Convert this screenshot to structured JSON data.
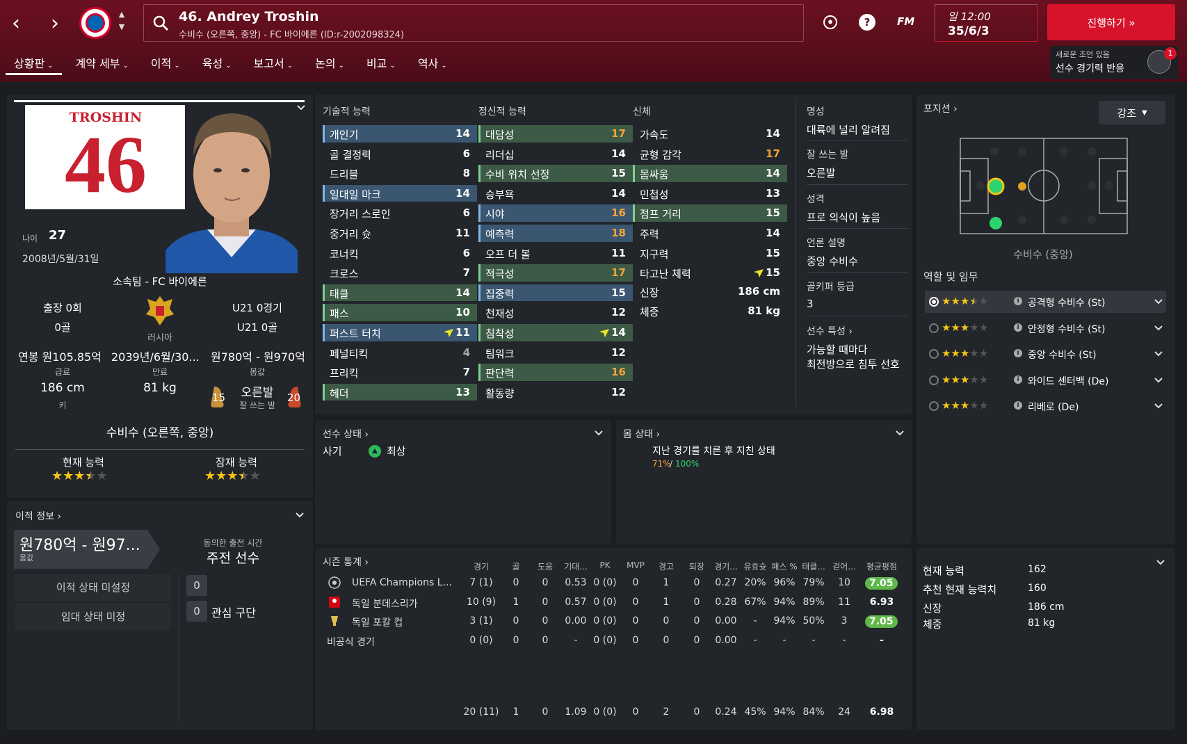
{
  "header": {
    "player_title": "46. Andrey Troshin",
    "player_sub": "수비수 (오른쪽, 중앙) - FC 바이에른 (ID:r-2002098324)",
    "fm_label": "FM",
    "time": "일 12:00",
    "date": "35/6/3",
    "continue_label": "진행하기 »",
    "notice_line1": "새로운 조언 있음",
    "notice_line2": "선수 경기력 반응",
    "notice_badge": "1"
  },
  "tabs": [
    {
      "label": "상황판"
    },
    {
      "label": "계약 세부"
    },
    {
      "label": "이적"
    },
    {
      "label": "육성"
    },
    {
      "label": "보고서"
    },
    {
      "label": "논의"
    },
    {
      "label": "비교"
    },
    {
      "label": "역사"
    }
  ],
  "profile": {
    "jersey_name": "TROSHIN",
    "jersey_number": "46",
    "age_label": "나이",
    "age": "27",
    "dob": "2008년/5월/31일",
    "club": "소속팀 - FC 바이에른",
    "apps": "출장 0회",
    "goals": "0골",
    "nation": "러시아",
    "u21_apps": "U21 0경기",
    "u21_goals": "U21 0골",
    "wage": "연봉 원105.85억",
    "expiry": "2039년/6월/30...",
    "value": "원780억 - 원970억",
    "wage_label": "급료",
    "expiry_label": "만료",
    "value_label": "몸값",
    "height": "186 cm",
    "height_label": "키",
    "weight": "81 kg",
    "foot": "오른발",
    "foot_label": "잘 쓰는 발",
    "left_foot_val": "15",
    "right_foot_val": "20",
    "position": "수비수 (오른쪽, 중앙)",
    "ca_label": "현재 능력",
    "pa_label": "잠재 능력",
    "ca_stars": 3.5,
    "pa_stars": 3.5
  },
  "attributes": {
    "tech_head": "기술적 능력",
    "mental_head": "정신적 능력",
    "phys_head": "신체",
    "technical": [
      {
        "name": "개인기",
        "value": "14",
        "hl": "blue"
      },
      {
        "name": "골 결정력",
        "value": "6",
        "hl": ""
      },
      {
        "name": "드리블",
        "value": "8",
        "hl": ""
      },
      {
        "name": "일대일 마크",
        "value": "14",
        "hl": "blue"
      },
      {
        "name": "장거리 스로인",
        "value": "6",
        "hl": ""
      },
      {
        "name": "중거리 슛",
        "value": "11",
        "hl": ""
      },
      {
        "name": "코너킥",
        "value": "6",
        "hl": ""
      },
      {
        "name": "크로스",
        "value": "7",
        "hl": ""
      },
      {
        "name": "태클",
        "value": "14",
        "hl": "green"
      },
      {
        "name": "패스",
        "value": "10",
        "hl": "green"
      },
      {
        "name": "퍼스트 터치",
        "value": "11",
        "hl": "blue",
        "arrow": true
      },
      {
        "name": "페널티킥",
        "value": "4",
        "hl": "",
        "grey": true
      },
      {
        "name": "프리킥",
        "value": "7",
        "hl": ""
      },
      {
        "name": "헤더",
        "value": "13",
        "hl": "green"
      }
    ],
    "mental": [
      {
        "name": "대담성",
        "value": "17",
        "hl": "green",
        "orange": true
      },
      {
        "name": "리더십",
        "value": "14",
        "hl": ""
      },
      {
        "name": "수비 위치 선정",
        "value": "15",
        "hl": "green"
      },
      {
        "name": "승부욕",
        "value": "14",
        "hl": ""
      },
      {
        "name": "시야",
        "value": "16",
        "hl": "blue",
        "orange": true
      },
      {
        "name": "예측력",
        "value": "18",
        "hl": "blue",
        "orange": true
      },
      {
        "name": "오프 더 볼",
        "value": "11",
        "hl": ""
      },
      {
        "name": "적극성",
        "value": "17",
        "hl": "green",
        "orange": true
      },
      {
        "name": "집중력",
        "value": "15",
        "hl": "blue"
      },
      {
        "name": "천재성",
        "value": "12",
        "hl": ""
      },
      {
        "name": "침착성",
        "value": "14",
        "hl": "green",
        "arrow": true
      },
      {
        "name": "팀워크",
        "value": "12",
        "hl": ""
      },
      {
        "name": "판단력",
        "value": "16",
        "hl": "green",
        "orange": true
      },
      {
        "name": "활동량",
        "value": "12",
        "hl": ""
      }
    ],
    "physical": [
      {
        "name": "가속도",
        "value": "14",
        "hl": ""
      },
      {
        "name": "균형 감각",
        "value": "17",
        "hl": "",
        "orange": true
      },
      {
        "name": "몸싸움",
        "value": "14",
        "hl": "green"
      },
      {
        "name": "민첩성",
        "value": "13",
        "hl": ""
      },
      {
        "name": "점프 거리",
        "value": "15",
        "hl": "green"
      },
      {
        "name": "주력",
        "value": "14",
        "hl": ""
      },
      {
        "name": "지구력",
        "value": "15",
        "hl": ""
      },
      {
        "name": "타고난 체력",
        "value": "15",
        "hl": "",
        "arrow": true
      }
    ],
    "height_label": "신장",
    "height": "186 cm",
    "weight_label": "체중",
    "weight": "81 kg"
  },
  "info": {
    "rep_label": "명성",
    "rep": "대륙에 널리 알려짐",
    "foot_label": "잘 쓰는 발",
    "foot": "오른발",
    "pers_label": "성격",
    "pers": "프로 의식이 높음",
    "media_label": "언론 설명",
    "media": "중앙 수비수",
    "gk_label": "골키퍼 등급",
    "gk": "3",
    "traits_label": "선수 특성",
    "trait1": "가능할 때마다",
    "trait2": "최전방으로 침투 선호"
  },
  "position_panel": {
    "head": "포지션",
    "emphasis": "강조",
    "pitch_caption": "수비수 (중앙)",
    "roles_head": "역할 및 임무",
    "roles": [
      {
        "name": "공격형 수비수 (St)",
        "stars": 3.5,
        "selected": true
      },
      {
        "name": "안정형 수비수 (St)",
        "stars": 3,
        "selected": false
      },
      {
        "name": "중앙 수비수 (St)",
        "stars": 3,
        "selected": false
      },
      {
        "name": "와이드 센터백 (De)",
        "stars": 3,
        "selected": false
      },
      {
        "name": "리베로 (De)",
        "stars": 3,
        "selected": false
      }
    ]
  },
  "transfer": {
    "head": "이적 정보",
    "value": "원780억 - 원97...",
    "value_label": "몸값",
    "agreed_label": "동의한 출전 시간",
    "agreed": "주전 선수",
    "status1": "이적 상태 미설정",
    "status2": "임대 상태 미정",
    "count1": "0",
    "count2": "0",
    "interest": "관심 구단"
  },
  "status": {
    "head": "선수 상태",
    "morale_label": "사기",
    "morale": "최상",
    "cond_head": "몸 상태",
    "cond_text": "지난 경기를 치른 후 지친 상태",
    "cond_a": "71%",
    "cond_sep": "/",
    "cond_b": "100%"
  },
  "season": {
    "head": "시즌 통계",
    "cols": [
      "경기",
      "골",
      "도움",
      "기대...",
      "PK",
      "MVP",
      "경고",
      "퇴장",
      "경기...",
      "유효슛",
      "패스 %",
      "태클...",
      "걷어...",
      "평균평점"
    ],
    "rows": [
      {
        "comp": "UEFA Champions L...",
        "cells": [
          "7 (1)",
          "0",
          "0",
          "0.53",
          "0 (0)",
          "0",
          "1",
          "0",
          "0.27",
          "20%",
          "96%",
          "79%",
          "10"
        ],
        "rating": "7.05",
        "pill": true
      },
      {
        "comp": "독일 분데스리가",
        "cells": [
          "10 (9)",
          "1",
          "0",
          "0.57",
          "0 (0)",
          "0",
          "1",
          "0",
          "0.28",
          "67%",
          "94%",
          "89%",
          "11"
        ],
        "rating": "6.93",
        "pill": false
      },
      {
        "comp": "독일 포칼 컵",
        "cells": [
          "3 (1)",
          "0",
          "0",
          "0.00",
          "0 (0)",
          "0",
          "0",
          "0",
          "0.00",
          "-",
          "94%",
          "50%",
          "3"
        ],
        "rating": "7.05",
        "pill": true
      },
      {
        "comp": "비공식 경기",
        "cells": [
          "0 (0)",
          "0",
          "0",
          "-",
          "0 (0)",
          "0",
          "0",
          "0",
          "0.00",
          "-",
          "-",
          "-",
          "-"
        ],
        "rating": "-",
        "pill": false
      }
    ],
    "total": {
      "cells": [
        "20 (11)",
        "1",
        "0",
        "1.09",
        "0 (0)",
        "0",
        "2",
        "0",
        "0.24",
        "45%",
        "94%",
        "84%",
        "24"
      ],
      "rating": "6.98"
    }
  },
  "summary": {
    "ca_label": "현재 능력",
    "ca": "162",
    "rec_label": "추천 현재 능력치",
    "rec": "160",
    "h_label": "신장",
    "h": "186 cm",
    "w_label": "체중",
    "w": "81 kg"
  },
  "colors": {
    "accent": "#d6132b",
    "header": "#5a0e1b",
    "panel": "#22252a",
    "highlight_blue": "#3a5670",
    "highlight_green": "#3c5a45",
    "orange_value": "#f5a43a"
  }
}
